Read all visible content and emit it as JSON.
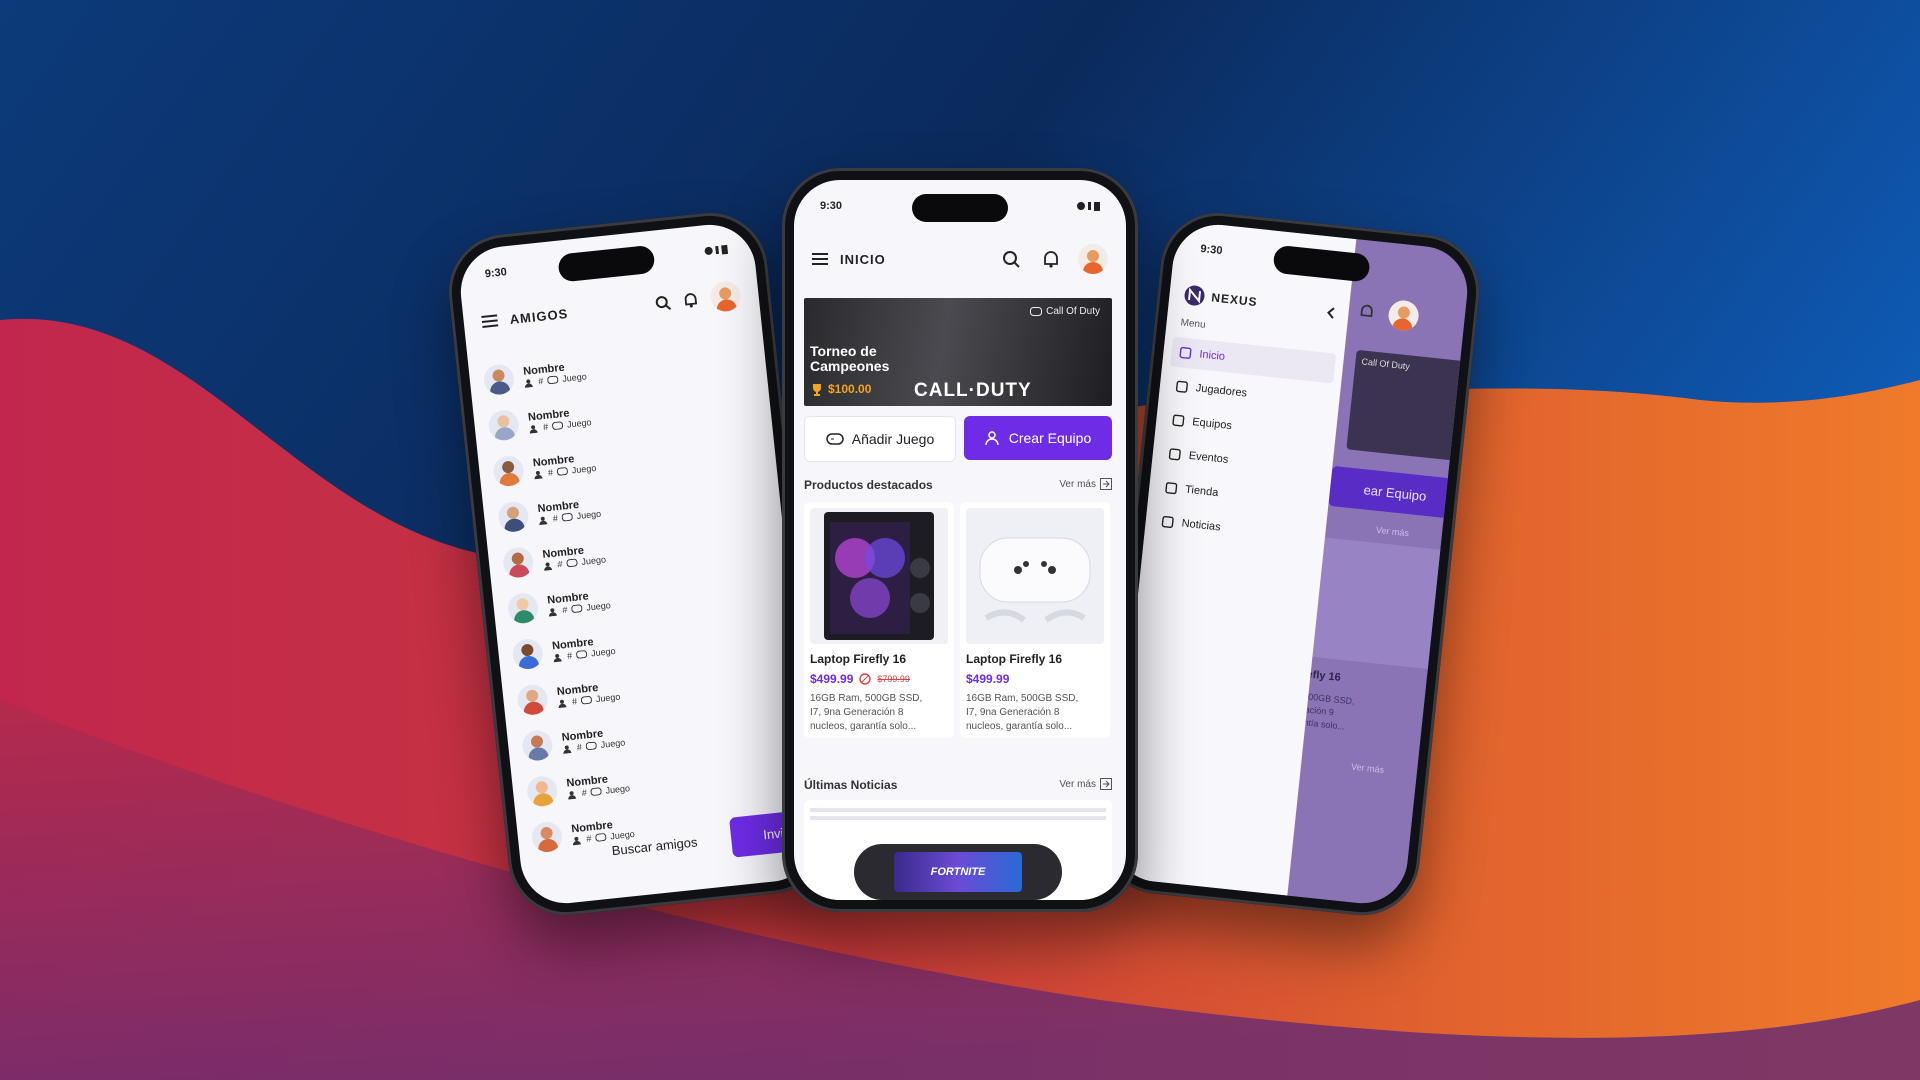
{
  "colors": {
    "accent": "#6e2ce6",
    "price": "#6e2ce6",
    "oldprice": "#d44",
    "gold": "#f2a520"
  },
  "left_phone": {
    "time": "9:30",
    "title": "AMIGOS",
    "friends": [
      {
        "name": "Nombre",
        "tag": "#",
        "game": "Juego"
      },
      {
        "name": "Nombre",
        "tag": "#",
        "game": "Juego"
      },
      {
        "name": "Nombre",
        "tag": "#",
        "game": "Juego"
      },
      {
        "name": "Nombre",
        "tag": "#",
        "game": "Juego"
      },
      {
        "name": "Nombre",
        "tag": "#",
        "game": "Juego"
      },
      {
        "name": "Nombre",
        "tag": "#",
        "game": "Juego"
      },
      {
        "name": "Nombre",
        "tag": "#",
        "game": "Juego"
      },
      {
        "name": "Nombre",
        "tag": "#",
        "game": "Juego"
      },
      {
        "name": "Nombre",
        "tag": "#",
        "game": "Juego"
      },
      {
        "name": "Nombre",
        "tag": "#",
        "game": "Juego"
      },
      {
        "name": "Nombre",
        "tag": "#",
        "game": "Juego"
      }
    ],
    "search_label": "Buscar amigos",
    "invite_label": "Invitar"
  },
  "center_phone": {
    "time": "9:30",
    "title": "INICIO",
    "banner": {
      "game_tag": "Call Of Duty",
      "title_line1": "Torneo de",
      "title_line2": "Campeones",
      "prize": "$100.00",
      "logo": "CALL·DUTY"
    },
    "add_game_label": "Añadir Juego",
    "create_team_label": "Crear Equipo",
    "featured": {
      "heading": "Productos destacados",
      "see_more": "Ver más"
    },
    "products": [
      {
        "name": "Laptop Firefly 16",
        "price": "$499.99",
        "old_price": "$799.99",
        "desc1": "16GB Ram, 500GB SSD,",
        "desc2": "I7, 9na Generación 8",
        "desc3": "nucleos, garantía solo..."
      },
      {
        "name": "Laptop Firefly 16",
        "price": "$499.99",
        "old_price": "",
        "desc1": "16GB Ram, 500GB SSD,",
        "desc2": "I7, 9na Generación 8",
        "desc3": "nucleos, garantía solo..."
      }
    ],
    "news": {
      "heading": "Últimas Noticias",
      "see_more": "Ver más",
      "img_text": "FORTNITE"
    }
  },
  "right_phone": {
    "time": "9:30",
    "brand": "NEXUS",
    "menu_label": "Menu",
    "items": [
      "Inicio",
      "Jugadores",
      "Equipos",
      "Eventos",
      "Tienda",
      "Noticias"
    ],
    "bg_banner_tag": "Call Of Duty",
    "bg_button": "ear Equipo",
    "bg_see_more": "Ver más",
    "bg_product": "efly 16",
    "bg_desc1": ", 500GB SSD,",
    "bg_desc2": "eración 9",
    "bg_desc3": "rantía solo...",
    "bg_see_more2": "Ver más"
  }
}
